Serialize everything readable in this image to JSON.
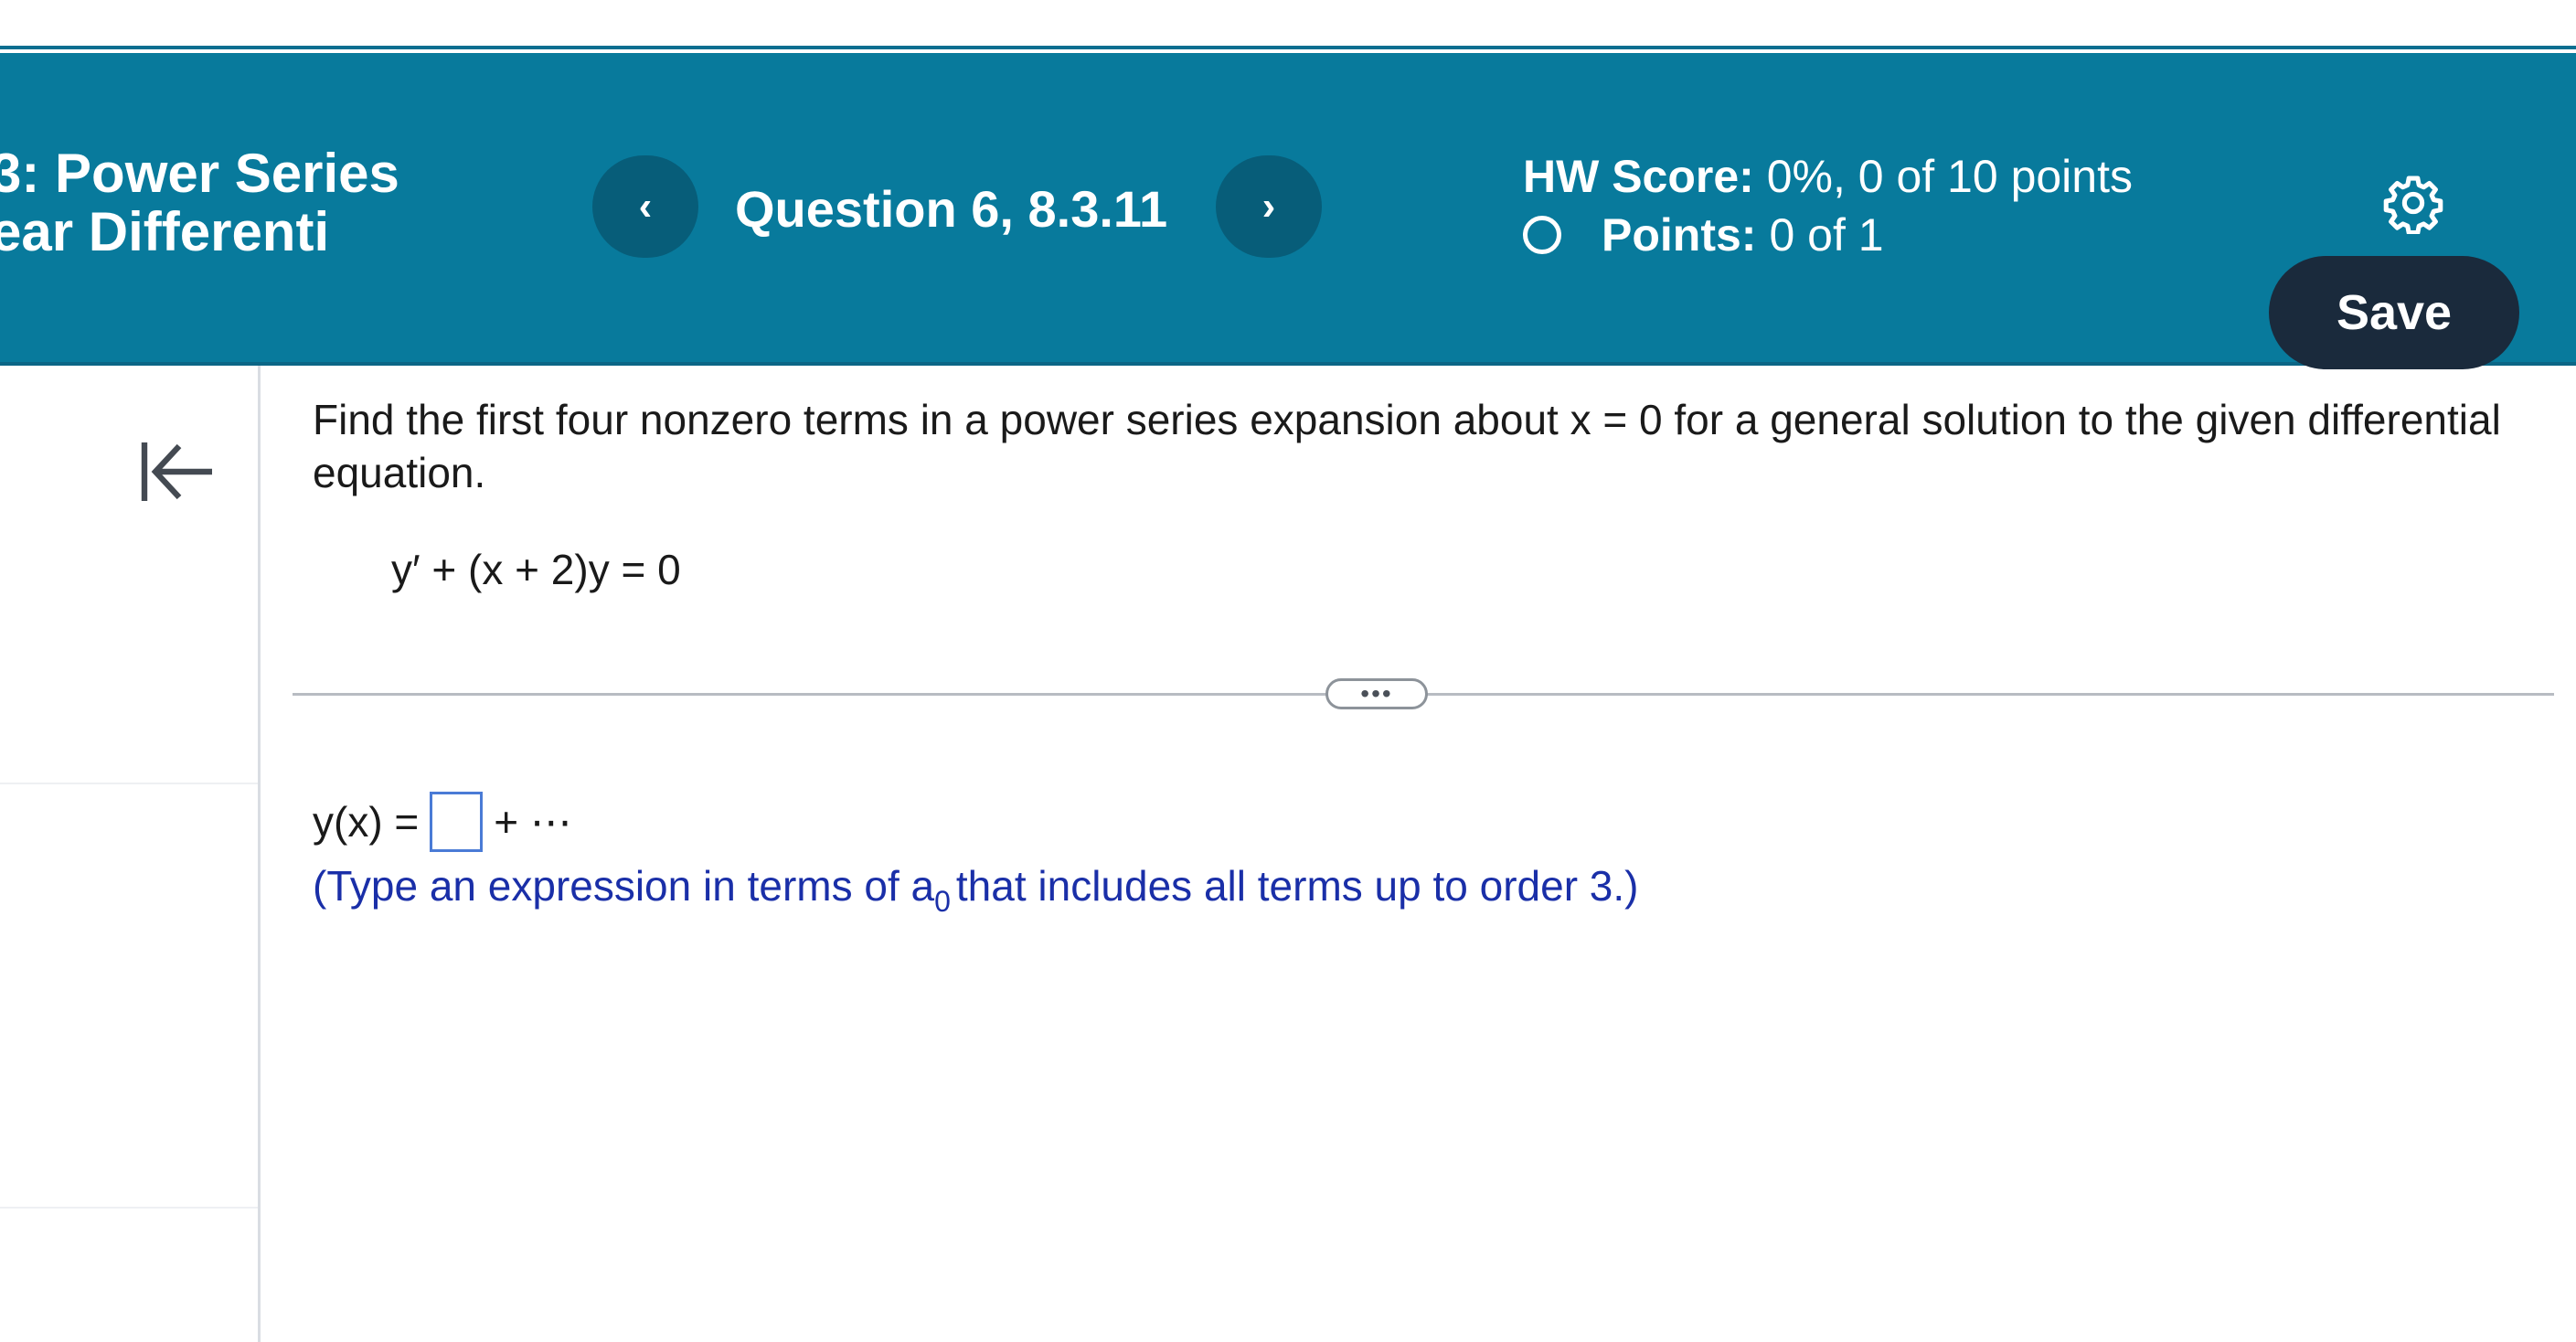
{
  "header": {
    "chapter_title": "3: Power Series\near Differenti",
    "question_label": "Question 6, 8.3.11",
    "prev_label": "‹",
    "next_label": "›",
    "hw_score_label": "HW Score:",
    "hw_score_value": "0%, 0 of 10 points",
    "points_label": "Points:",
    "points_value": "0 of 1",
    "save_label": "Save",
    "settings_icon": "gear-icon"
  },
  "sidebar": {
    "collapse_icon": "collapse-left-icon"
  },
  "question": {
    "instructions": "Find the first four nonzero terms in a power series expansion about x = 0 for a general solution to the given differential equation.",
    "equation": "y′ + (x + 2)y = 0",
    "more_handle": "•••"
  },
  "answer": {
    "lhs": "y(x) =",
    "input_value": "",
    "suffix": "+ ⋯",
    "hint_prefix": "(Type an expression in terms of a",
    "hint_subscript": "0",
    "hint_suffix": "that includes all terms up to order 3.)"
  },
  "colors": {
    "header_bg": "#087a9c",
    "nav_button_bg": "#075d79",
    "save_button_bg": "#1a2a3c",
    "hint_text": "#1a2fa8",
    "input_border": "#4a7bd6"
  }
}
